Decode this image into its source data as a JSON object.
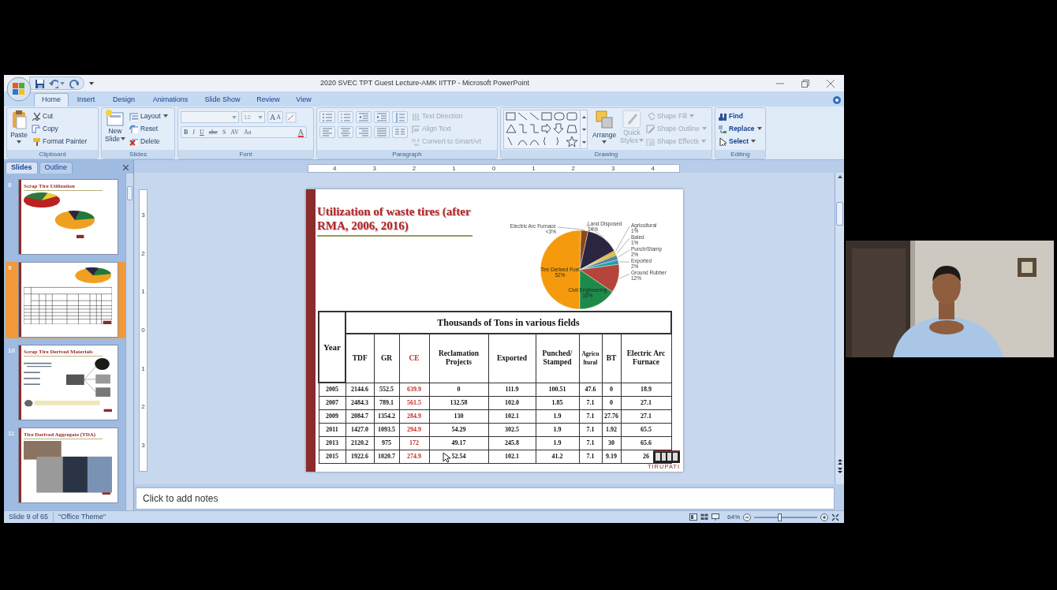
{
  "window": {
    "title": "2020 SVEC TPT Guest Lecture-AMK IITTP - Microsoft PowerPoint"
  },
  "tabs": [
    {
      "label": "Home",
      "selected": true
    },
    {
      "label": "Insert",
      "selected": false
    },
    {
      "label": "Design",
      "selected": false
    },
    {
      "label": "Animations",
      "selected": false
    },
    {
      "label": "Slide Show",
      "selected": false
    },
    {
      "label": "Review",
      "selected": false
    },
    {
      "label": "View",
      "selected": false
    }
  ],
  "ribbon": {
    "clipboard": {
      "label": "Clipboard",
      "paste": "Paste",
      "items": [
        {
          "label": "Cut",
          "kind": "cut"
        },
        {
          "label": "Copy",
          "kind": "copy"
        },
        {
          "label": "Format Painter",
          "kind": "painter"
        }
      ]
    },
    "slides": {
      "label": "Slides",
      "new_slide": [
        "New",
        "Slide"
      ],
      "items": [
        {
          "label": "Layout",
          "kind": "layout",
          "caret": true
        },
        {
          "label": "Reset",
          "kind": "reset",
          "caret": false
        },
        {
          "label": "Delete",
          "kind": "delete",
          "caret": false
        }
      ]
    },
    "font": {
      "label": "Font",
      "size": "12",
      "grow_shrink": [
        "A",
        "A"
      ],
      "buttons": [
        "B",
        "I",
        "U",
        "abe",
        "S",
        "AV",
        "Aa",
        "A"
      ]
    },
    "paragraph": {
      "label": "Paragraph",
      "items": [
        {
          "label": "Text Direction",
          "kind": "textdir",
          "disabled": true
        },
        {
          "label": "Align Text",
          "kind": "aligntext",
          "disabled": true
        },
        {
          "label": "Convert to SmartArt",
          "kind": "smartart",
          "disabled": true
        }
      ]
    },
    "drawing": {
      "label": "Drawing",
      "arrange": "Arrange",
      "quick_styles": [
        "Quick",
        "Styles"
      ],
      "items": [
        {
          "label": "Shape Fill",
          "kind": "fill",
          "disabled": true
        },
        {
          "label": "Shape Outline",
          "kind": "outline",
          "disabled": true
        },
        {
          "label": "Shape Effects",
          "kind": "effects",
          "disabled": true
        }
      ]
    },
    "editing": {
      "label": "Editing",
      "items": [
        {
          "label": "Find",
          "kind": "find",
          "caret": false
        },
        {
          "label": "Replace",
          "kind": "replace",
          "caret": true
        },
        {
          "label": "Select",
          "kind": "select",
          "caret": true
        }
      ]
    }
  },
  "panel": {
    "tabs": [
      {
        "label": "Slides",
        "selected": true
      },
      {
        "label": "Outline",
        "selected": false
      }
    ],
    "slides": [
      {
        "number": "8",
        "kind": "pie",
        "title": "Scrap Tire Utilization",
        "selected": false
      },
      {
        "number": "9",
        "kind": "pie_table",
        "selected": true
      },
      {
        "number": "10",
        "kind": "bullets_images",
        "title": "Scrap Tire Derived Materials",
        "selected": false
      },
      {
        "number": "11",
        "kind": "photos",
        "title": "Tire Derived Aggregate (TDA)",
        "selected": false
      }
    ]
  },
  "rulers": {
    "horizontal": [
      "4",
      "3",
      "2",
      "1",
      "0",
      "1",
      "2",
      "3",
      "4"
    ],
    "vertical": [
      "3",
      "2",
      "1",
      "0",
      "1",
      "2",
      "3"
    ]
  },
  "slide": {
    "title": "Utilization of waste tires (after RMA, 2006, 2016)",
    "chart_data": {
      "type": "pie",
      "categories": [
        "Tire Derived Fuel",
        "Electric Arc Furnace",
        "Land Disposed",
        "Agricultural",
        "Baled",
        "Punch/Stamp",
        "Exported",
        "Ground Rubber",
        "Civil Engineering"
      ],
      "series": [
        {
          "values": [
            50.5,
            2.9,
            13.6,
            1.0,
            1.0,
            1.9,
            1.9,
            11.7,
            15.5
          ]
        }
      ],
      "value_labels": [
        "52%",
        "<3%",
        "14%",
        "1%",
        "1%",
        "2%",
        "2%",
        "12%",
        "16%"
      ]
    },
    "table": {
      "group_heading": "Thousands of Tons in various fields",
      "columns": [
        {
          "label": "Year",
          "highlighted": false
        },
        {
          "label": "TDF",
          "highlighted": false
        },
        {
          "label": "GR",
          "highlighted": false
        },
        {
          "label": "CE",
          "highlighted": true
        },
        {
          "label": "Reclamation Projects",
          "highlighted": false
        },
        {
          "label": "Exported",
          "highlighted": false
        },
        {
          "label": "Punched/ Stamped",
          "highlighted": false
        },
        {
          "label": "Agricu ltural",
          "highlighted": false
        },
        {
          "label": "BT",
          "highlighted": false
        },
        {
          "label": "Electric Arc Furnace",
          "highlighted": false
        }
      ],
      "rows": [
        [
          "2005",
          "2144.6",
          "552.5",
          "639.9",
          "0",
          "111.9",
          "100.51",
          "47.6",
          "0",
          "18.9"
        ],
        [
          "2007",
          "2484.3",
          "789.1",
          "561.5",
          "132.58",
          "102.0",
          "1.85",
          "7.1",
          "0",
          "27.1"
        ],
        [
          "2009",
          "2084.7",
          "1354.2",
          "284.9",
          "130",
          "102.1",
          "1.9",
          "7.1",
          "27.76",
          "27.1"
        ],
        [
          "2011",
          "1427.0",
          "1093.5",
          "294.9",
          "54.29",
          "302.5",
          "1.9",
          "7.1",
          "1.92",
          "65.5"
        ],
        [
          "2013",
          "2120.2",
          "975",
          "172",
          "49.17",
          "245.8",
          "1.9",
          "7.1",
          "30",
          "65.6"
        ],
        [
          "2015",
          "1922.6",
          "1020.7",
          "274.9",
          "52.54",
          "102.1",
          "41.2",
          "7.1",
          "9.19",
          "26"
        ]
      ]
    },
    "logo_caption": "TIRUPATI"
  },
  "notes": {
    "placeholder": "Click to add notes"
  },
  "status_bar": {
    "slide": "Slide 9 of 65",
    "theme": "\"Office Theme\"",
    "zoom": "64%",
    "zoom_slider": {
      "level": 0.4
    }
  }
}
